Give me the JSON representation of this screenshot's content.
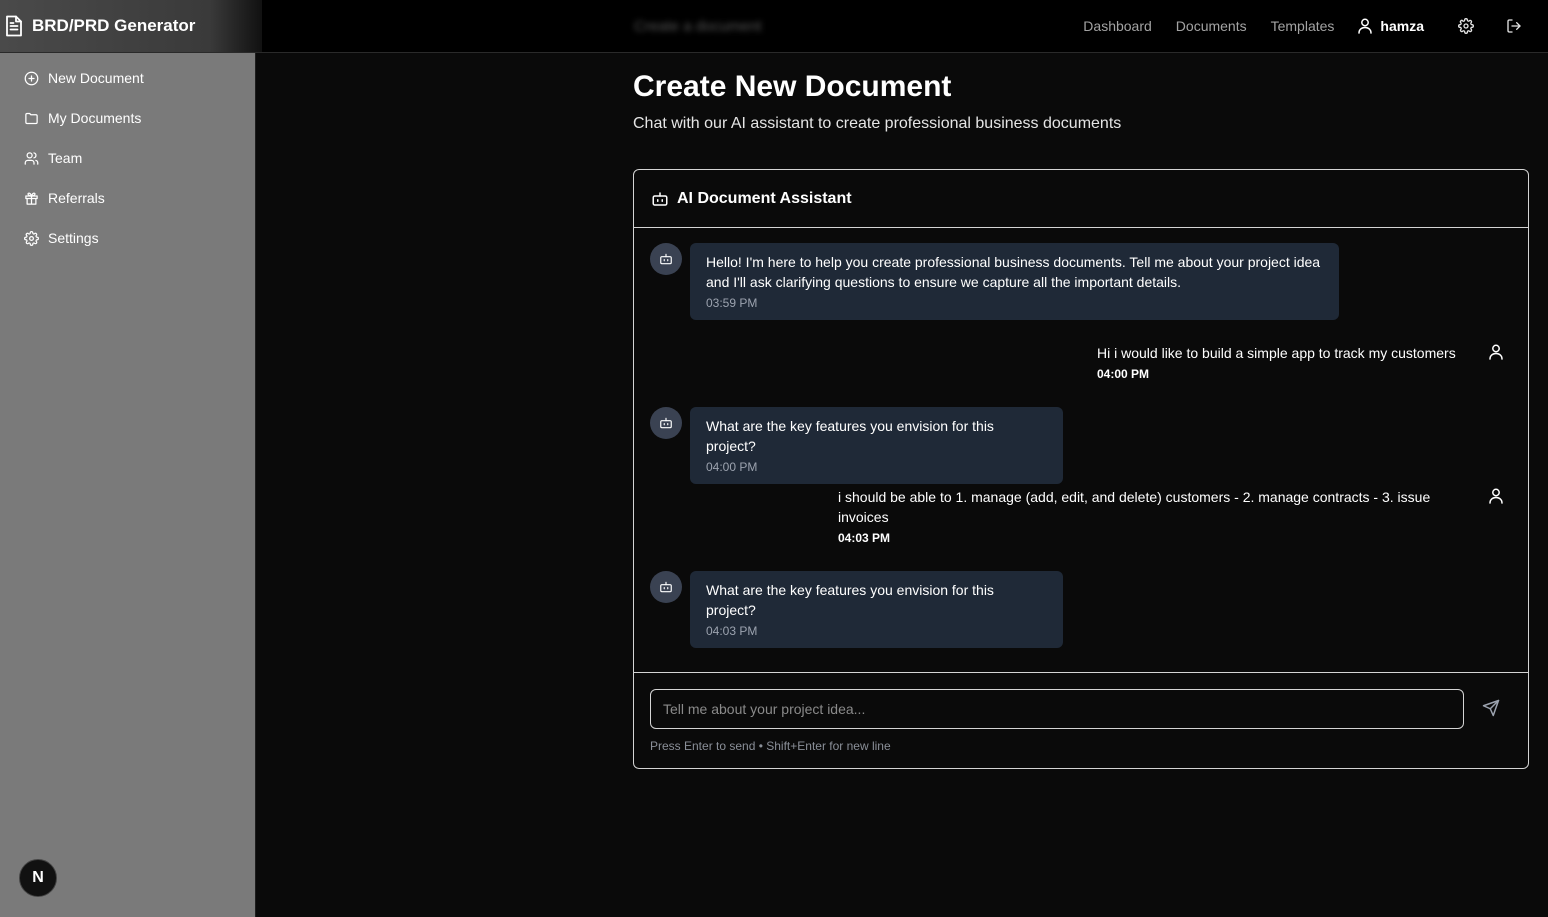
{
  "brand": {
    "title": "BRD/PRD Generator"
  },
  "header": {
    "blurred_title": "Create a document",
    "nav": [
      "Dashboard",
      "Documents",
      "Templates"
    ],
    "user_name": "hamza"
  },
  "sidebar": {
    "items": [
      {
        "label": "New Document",
        "icon": "plus-circle-icon"
      },
      {
        "label": "My Documents",
        "icon": "folder-icon"
      },
      {
        "label": "Team",
        "icon": "users-icon"
      },
      {
        "label": "Referrals",
        "icon": "gift-icon"
      },
      {
        "label": "Settings",
        "icon": "gear-icon"
      }
    ],
    "badge": "N"
  },
  "main": {
    "title": "Create New Document",
    "subtitle": "Chat with our AI assistant to create professional business documents"
  },
  "assistant": {
    "title": "AI Document Assistant",
    "messages": [
      {
        "role": "bot",
        "line1": "Hello! I'm here to help you create professional business documents. Tell me about your project idea",
        "line2": "and I'll ask clarifying questions to ensure we capture all the important details.",
        "time": "03:59 PM"
      },
      {
        "role": "user",
        "line1": "Hi i would like to build a simple app to track my customers",
        "time": "04:00 PM"
      },
      {
        "role": "bot",
        "line1": "What are the key features you envision for this project?",
        "time": "04:00 PM"
      },
      {
        "role": "user",
        "line1": "i should be able to 1. manage (add, edit, and delete) customers - 2. manage contracts - 3. issue",
        "line2": "invoices",
        "time": "04:03 PM"
      },
      {
        "role": "bot",
        "line1": "What are the key features you envision for this project?",
        "time": "04:03 PM"
      }
    ],
    "input_placeholder": "Tell me about your project idea...",
    "hint": "Press Enter to send • Shift+Enter for new line"
  },
  "colors": {
    "background": "#0a0a0a",
    "sidebar": "#7a7a7a",
    "bubble": "#1f2937",
    "avatar": "#3a4252"
  }
}
